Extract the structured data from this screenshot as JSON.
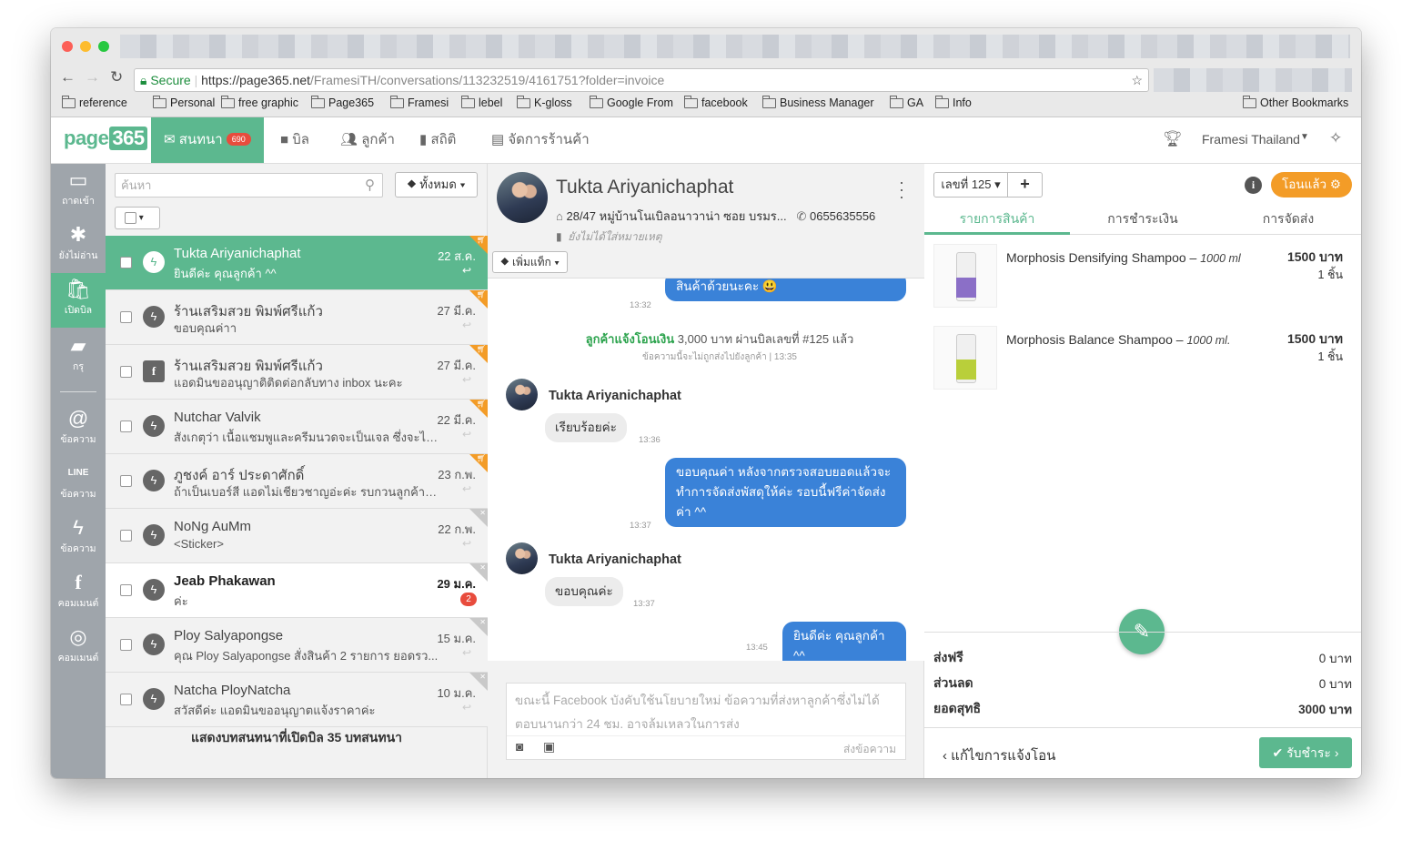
{
  "browser": {
    "url_secure": "Secure",
    "url_host": "https://page365.net",
    "url_path": "/FramesiTH/conversations/113232519/4161751?folder=invoice",
    "bookmarks": [
      "reference",
      "Personal",
      "free graphic",
      "Page365",
      "Framesi",
      "lebel",
      "K-gloss",
      "Google From",
      "facebook",
      "Business Manager",
      "GA",
      "Info"
    ],
    "other_bookmarks": "Other Bookmarks"
  },
  "app": {
    "logo_text": "page",
    "logo_num": "365",
    "tabs": {
      "chat": "สนทนา",
      "chat_badge": "690",
      "bill": "บิล",
      "customers": "ลูกค้า",
      "stats": "สถิติ",
      "store": "จัดการร้านค้า"
    },
    "account": "Framesi Thailand"
  },
  "leftbar": {
    "inbox": "ถาดเข้า",
    "unread": "ยังไม่อ่าน",
    "open_bill": "เปิดบิล",
    "folder": "กรุ",
    "email": "ข้อความ",
    "line": "ข้อความ",
    "messenger": "ข้อความ",
    "fb_comment": "คอมเมนต์",
    "ig_comment": "คอมเมนต์"
  },
  "list": {
    "search_placeholder": "ค้นหา",
    "filter_label": "ทั้งหมด",
    "footer": "แสดงบทสนทนาที่เปิดบิล 35 บทสนทนา",
    "items": [
      {
        "name": "Tukta Ariyanichaphat",
        "msg": "ยินดีค่ะ คุณลูกค้า ^^",
        "date": "22 ส.ค."
      },
      {
        "name": "ร้านเสริมสวย พิมพ์ศรีแก้ว",
        "msg": "ขอบคุณค่าา",
        "date": "27 มี.ค."
      },
      {
        "name": "ร้านเสริมสวย พิมพ์ศรีแก้ว",
        "msg": "แอดมินขออนุญาติติดต่อกลับทาง inbox นะคะ",
        "date": "27 มี.ค."
      },
      {
        "name": "Nutchar Valvik",
        "msg": "สังเกตุว่า เนื้อแชมพูและครีมนวดจะเป็นเจล ซึ่งจะไม่ที่...",
        "date": "22 มี.ค."
      },
      {
        "name": "ภูชงค์ อาร์ ประดาศักดิ์",
        "msg": "ถ้าเป็นเบอร์สี แอดไม่เชียวชาญอ่ะค่ะ รบกวนลูกค้าส่ง...",
        "date": "23 ก.พ."
      },
      {
        "name": "NoNg AuMm",
        "msg": "<Sticker>",
        "date": "22 ก.พ."
      },
      {
        "name": "Jeab Phakawan",
        "msg": "ค่ะ",
        "date": "29 ม.ค.",
        "unread": "2"
      },
      {
        "name": "Ploy Salyapongse",
        "msg": "คุณ Ploy Salyapongse สั่งสินค้า 2 รายการ ยอดรว...",
        "date": "15 ม.ค."
      },
      {
        "name": "Natcha PloyNatcha",
        "msg": "สวัสดีค่ะ แอดมินขออนุญาตแจ้งราคาค่ะ",
        "date": "10 ม.ค."
      }
    ]
  },
  "chat": {
    "name": "Tukta Ariyanichaphat",
    "address": "28/47 หมู่บ้านโนเบิลอนาวาน่า ซอย บรมร...",
    "phone": "0655635556",
    "note": "ยังไม่ได้ใส่หมายเหตุ",
    "add_tag": "เพิ่มแท็ก",
    "messages": {
      "m1": "สินค้าด้วยนะคะ 😃",
      "m1_time": "13:32",
      "sys_a": "ลูกค้าแจ้งโอนเงิน",
      "sys_b": "3,000 บาท ผ่านบิลเลขที่ #125 แล้ว",
      "sys_sub": "ข้อความนี้จะไม่ถูกส่งไปยังลูกค้า | 13:35",
      "sender": "Tukta Ariyanichaphat",
      "m2": "เรียบร้อยค่ะ",
      "m2_time": "13:36",
      "m3": "ขอบคุณค่า หลังจากตรวจสอบยอดแล้วจะทำการจัดส่งพัสดุให้ค่ะ รอบนี้ฟรีค่าจัดส่งค่า ^^",
      "m3_time": "13:37",
      "m4": "ขอบคุณค่ะ",
      "m4_time": "13:37",
      "m5": "ยินดีค่ะ คุณลูกค้า ^^",
      "m5_time": "13:45"
    },
    "composer_placeholder": "ขณะนี้ Facebook บังคับใช้นโยบายใหม่ ข้อความที่ส่งหาลูกค้าซึ่งไม่ได้ตอบนานกว่า 24 ชม. อาจล้มเหลวในการส่ง",
    "send": "ส่งข้อความ"
  },
  "bill": {
    "number": "เลขที่ 125",
    "status": "โอนแล้ว",
    "tabs": [
      "รายการสินค้า",
      "การชำระเงิน",
      "การจัดส่ง"
    ],
    "products": [
      {
        "name": "Morphosis Densifying Shampoo",
        "variant": "1000 ml",
        "price": "1500 บาท",
        "qty": "1 ชิ้น",
        "label_color": "#8b6fc7"
      },
      {
        "name": "Morphosis Balance Shampoo",
        "variant": "1000 ml.",
        "price": "1500 บาท",
        "qty": "1 ชิ้น",
        "label_color": "#b9cf3a"
      }
    ],
    "shipping_label": "ส่งฟรี",
    "shipping": "0 บาท",
    "discount_label": "ส่วนลด",
    "discount": "0 บาท",
    "net_label": "ยอดสุทธิ",
    "net": "3000 บาท",
    "edit_payment": "แก้ไขการแจ้งโอน",
    "receive": "รับชำระ"
  },
  "colors": {
    "brand": "#5cb88f",
    "orange": "#f39c27",
    "blue": "#3a82d8",
    "red": "#e84c3d"
  }
}
